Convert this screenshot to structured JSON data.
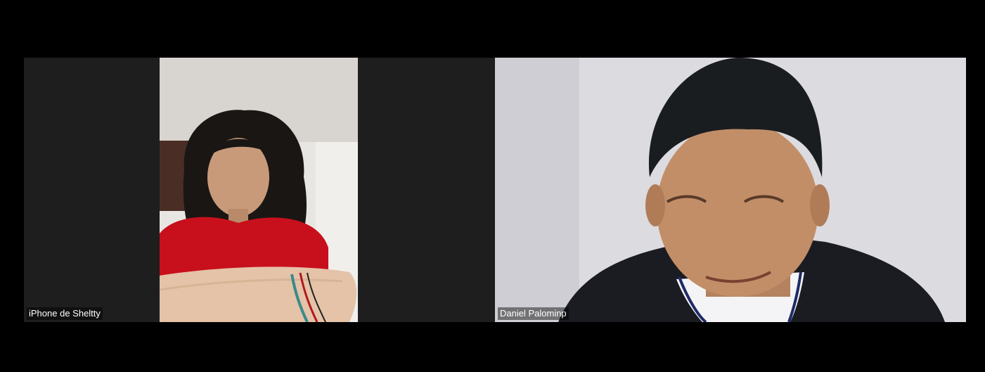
{
  "participants": [
    {
      "name": "iPhone de Sheltty"
    },
    {
      "name": "Daniel Palominp"
    }
  ],
  "colors": {
    "stage_background": "#000000",
    "tile_background": "#1e1e1e",
    "label_text": "#ffffff"
  }
}
